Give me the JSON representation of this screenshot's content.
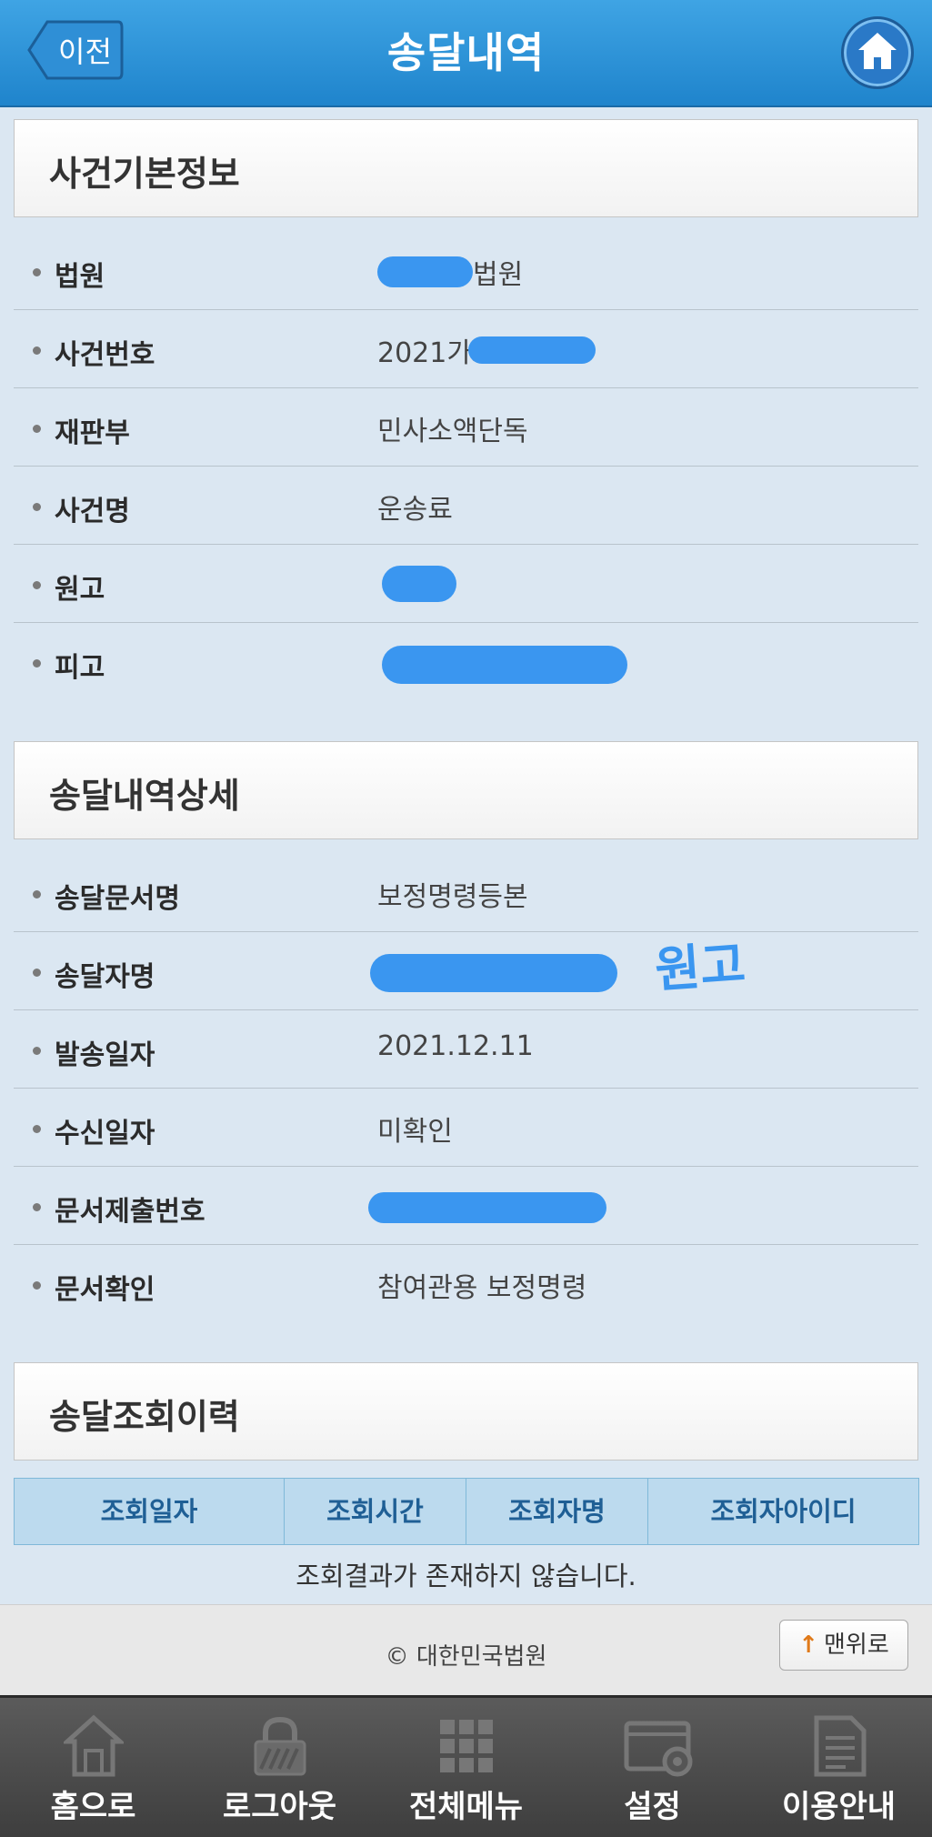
{
  "header": {
    "title": "송달내역",
    "back_label": "이전"
  },
  "case_info": {
    "section_title": "사건기본정보",
    "rows": [
      {
        "label": "법원",
        "value": "법원"
      },
      {
        "label": "사건번호",
        "value": "2021가소"
      },
      {
        "label": "재판부",
        "value": "민사소액단독"
      },
      {
        "label": "사건명",
        "value": "운송료"
      },
      {
        "label": "원고",
        "value": ""
      },
      {
        "label": "피고",
        "value": ""
      }
    ]
  },
  "delivery_detail": {
    "section_title": "송달내역상세",
    "rows": [
      {
        "label": "송달문서명",
        "value": "보정명령등본"
      },
      {
        "label": "송달자명",
        "value": ""
      },
      {
        "label": "발송일자",
        "value": "2021.12.11"
      },
      {
        "label": "수신일자",
        "value": "미확인"
      },
      {
        "label": "문서제출번호",
        "value": ""
      },
      {
        "label": "문서확인",
        "value": "참여관용 보정명령"
      }
    ],
    "handwritten_note": "원고"
  },
  "lookup_history": {
    "section_title": "송달조회이력",
    "columns": [
      "조회일자",
      "조회시간",
      "조회자명",
      "조회자아이디"
    ],
    "empty_message": "조회결과가 존재하지 않습니다."
  },
  "footer": {
    "copyright": "© 대한민국법원",
    "top_button": "맨위로"
  },
  "bottom_nav": [
    {
      "label": "홈으로",
      "icon": "house-icon"
    },
    {
      "label": "로그아웃",
      "icon": "lock-icon"
    },
    {
      "label": "전체메뉴",
      "icon": "grid-icon"
    },
    {
      "label": "설정",
      "icon": "settings-icon"
    },
    {
      "label": "이용안내",
      "icon": "document-icon"
    }
  ],
  "colors": {
    "header": "#2a8fd8",
    "background": "#dbe7f2",
    "redaction": "#3a96f0",
    "table_header": "#bcdaee"
  }
}
